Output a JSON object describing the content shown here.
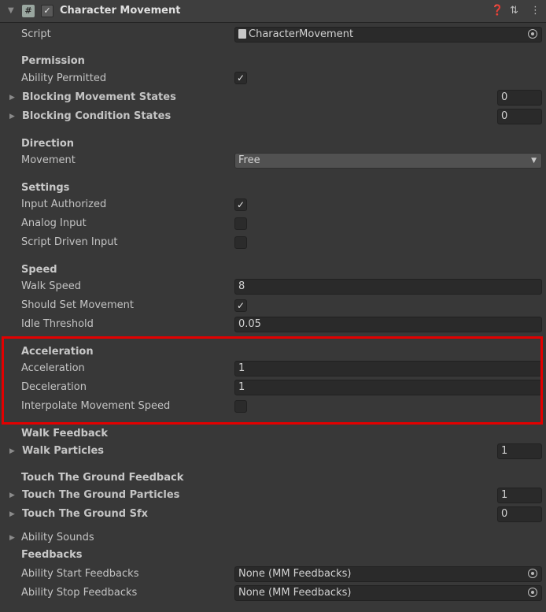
{
  "header": {
    "title": "Character Movement",
    "enabled": true
  },
  "script_field": {
    "label": "Script",
    "value": "CharacterMovement"
  },
  "permission": {
    "heading": "Permission",
    "ability_permitted_label": "Ability Permitted",
    "ability_permitted": true,
    "blocking_movement_label": "Blocking Movement States",
    "blocking_movement_value": "0",
    "blocking_condition_label": "Blocking Condition States",
    "blocking_condition_value": "0"
  },
  "direction": {
    "heading": "Direction",
    "movement_label": "Movement",
    "movement_value": "Free"
  },
  "settings": {
    "heading": "Settings",
    "input_authorized_label": "Input Authorized",
    "input_authorized": true,
    "analog_input_label": "Analog Input",
    "analog_input": false,
    "script_driven_label": "Script Driven Input",
    "script_driven": false
  },
  "speed": {
    "heading": "Speed",
    "walk_speed_label": "Walk Speed",
    "walk_speed_value": "8",
    "should_set_label": "Should Set Movement",
    "should_set": true,
    "idle_threshold_label": "Idle Threshold",
    "idle_threshold_value": "0.05"
  },
  "acceleration": {
    "heading": "Acceleration",
    "acceleration_label": "Acceleration",
    "acceleration_value": "1",
    "deceleration_label": "Deceleration",
    "deceleration_value": "1",
    "interpolate_label": "Interpolate Movement Speed",
    "interpolate": false
  },
  "walk_feedback": {
    "heading": "Walk Feedback",
    "walk_particles_label": "Walk Particles",
    "walk_particles_value": "1"
  },
  "touch_ground": {
    "heading": "Touch The Ground Feedback",
    "particles_label": "Touch The Ground Particles",
    "particles_value": "1",
    "sfx_label": "Touch The Ground Sfx",
    "sfx_value": "0"
  },
  "ability_sounds_label": "Ability Sounds",
  "feedbacks": {
    "heading": "Feedbacks",
    "start_label": "Ability Start Feedbacks",
    "start_value": "None (MM Feedbacks)",
    "stop_label": "Ability Stop Feedbacks",
    "stop_value": "None (MM Feedbacks)"
  },
  "colors": {
    "highlight": "#e30000",
    "background": "#383838"
  }
}
